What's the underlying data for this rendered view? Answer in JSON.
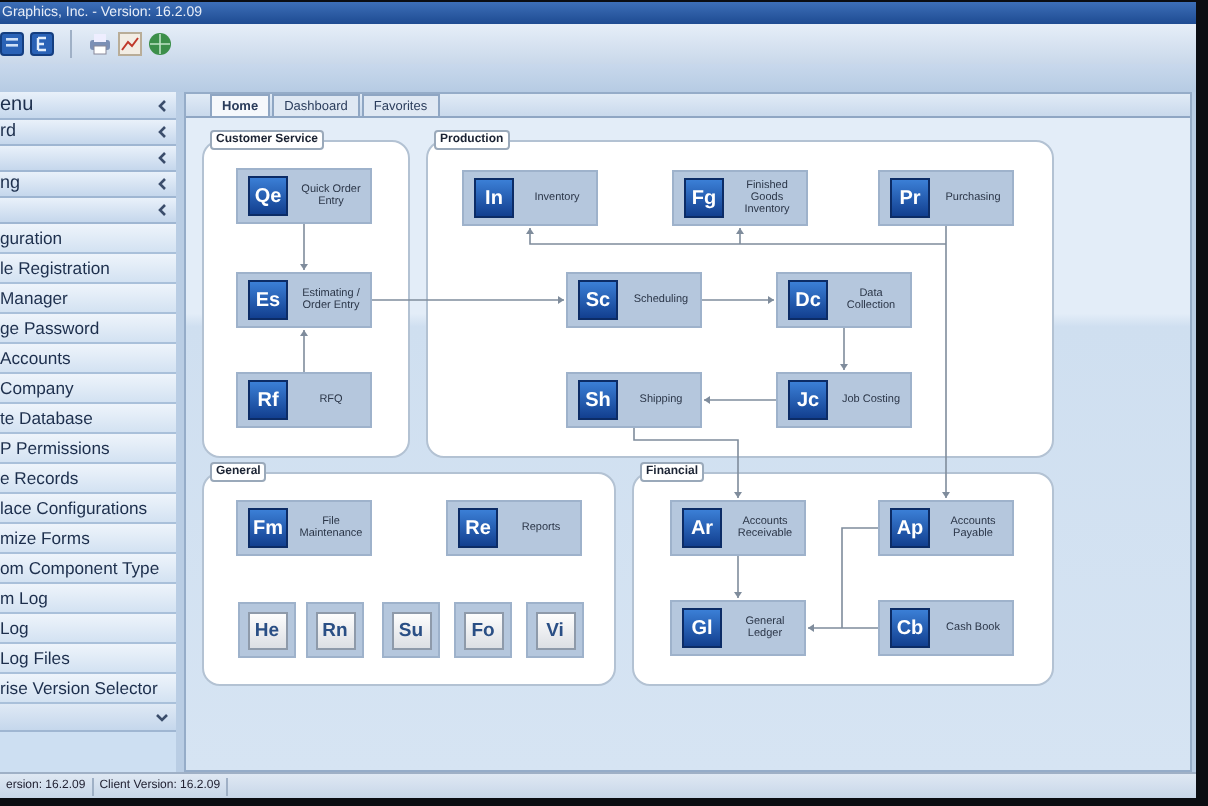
{
  "window": {
    "title": "Graphics, Inc. - Version: 16.2.09"
  },
  "sidebar": {
    "header": {
      "label": "enu",
      "expanded": false
    },
    "groups": [
      {
        "label": "rd",
        "expanded": false
      },
      {
        "expanded": false
      },
      {
        "label": "ng",
        "expanded": false
      },
      {
        "expanded": false
      }
    ],
    "items": [
      "guration",
      "le Registration",
      "Manager",
      "ge Password",
      "Accounts",
      "Company",
      "te Database",
      "P Permissions",
      "e Records",
      "lace Configurations",
      "mize Forms",
      "om Component Type",
      "m Log",
      "Log",
      "Log Files",
      "rise Version Selector"
    ],
    "footer": {
      "expanded": true
    }
  },
  "tabs": [
    {
      "label": "Home",
      "selected": true
    },
    {
      "label": "Dashboard",
      "selected": false
    },
    {
      "label": "Favorites",
      "selected": false
    }
  ],
  "panels": [
    {
      "title": "Customer Service",
      "nodes": [
        {
          "kind": "module",
          "code": "Qe",
          "label": "Quick Order Entry"
        },
        {
          "kind": "module",
          "code": "Es",
          "label": "Estimating / Order Entry"
        },
        {
          "kind": "module",
          "code": "Rf",
          "label": "RFQ"
        }
      ]
    },
    {
      "title": "Production",
      "nodes": [
        {
          "kind": "module",
          "code": "In",
          "label": "Inventory"
        },
        {
          "kind": "module",
          "code": "Fg",
          "label": "Finished Goods Inventory"
        },
        {
          "kind": "module",
          "code": "Pr",
          "label": "Purchasing"
        },
        {
          "kind": "module",
          "code": "Sc",
          "label": "Scheduling"
        },
        {
          "kind": "module",
          "code": "Dc",
          "label": "Data Collection"
        },
        {
          "kind": "module",
          "code": "Sh",
          "label": "Shipping"
        },
        {
          "kind": "module",
          "code": "Jc",
          "label": "Job Costing"
        }
      ]
    },
    {
      "title": "General",
      "nodes": [
        {
          "kind": "module",
          "code": "Fm",
          "label": "File Maintenance"
        },
        {
          "kind": "module",
          "code": "Re",
          "label": "Reports"
        },
        {
          "kind": "shortcut",
          "code": "He"
        },
        {
          "kind": "shortcut",
          "code": "Rn"
        },
        {
          "kind": "shortcut",
          "code": "Su"
        },
        {
          "kind": "shortcut",
          "code": "Fo"
        },
        {
          "kind": "shortcut",
          "code": "Vi"
        }
      ]
    },
    {
      "title": "Financial",
      "nodes": [
        {
          "kind": "module",
          "code": "Ar",
          "label": "Accounts Receivable"
        },
        {
          "kind": "module",
          "code": "Ap",
          "label": "Accounts Payable"
        },
        {
          "kind": "module",
          "code": "Gl",
          "label": "General Ledger"
        },
        {
          "kind": "module",
          "code": "Cb",
          "label": "Cash Book"
        }
      ]
    }
  ],
  "status_bar": [
    "ersion: 16.2.09",
    "Client Version: 16.2.09"
  ]
}
